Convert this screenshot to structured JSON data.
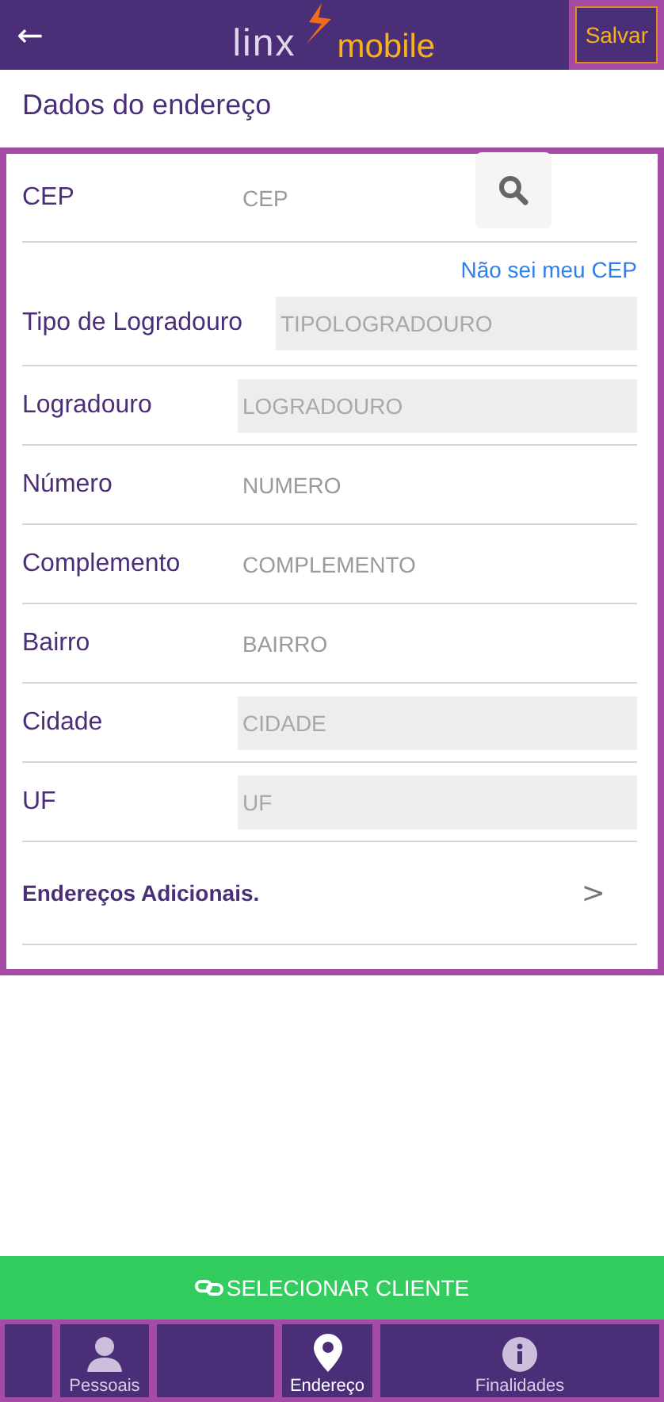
{
  "header": {
    "back": "←",
    "logo_left": "linx",
    "logo_right": "mobile",
    "save": "Salvar"
  },
  "title": "Dados do endereço",
  "cep": {
    "label": "CEP",
    "placeholder": "CEP",
    "link": "Não sei meu CEP"
  },
  "fields": [
    {
      "label": "Tipo de Logradouro",
      "placeholder": "TIPOLOGRADOURO",
      "readonly": true
    },
    {
      "label": "Logradouro",
      "placeholder": "LOGRADOURO",
      "readonly": true
    },
    {
      "label": "Número",
      "placeholder": "NUMERO",
      "readonly": false
    },
    {
      "label": "Complemento",
      "placeholder": "COMPLEMENTO",
      "readonly": false
    },
    {
      "label": "Bairro",
      "placeholder": "BAIRRO",
      "readonly": false
    },
    {
      "label": "Cidade",
      "placeholder": "CIDADE",
      "readonly": true
    },
    {
      "label": "UF",
      "placeholder": "UF",
      "readonly": true
    }
  ],
  "additional": {
    "label": "Endereços Adicionais.",
    "chevron": ">"
  },
  "select_button": "SELECIONAR CLIENTE",
  "tabs": [
    {
      "kind": "blank"
    },
    {
      "kind": "person",
      "label": "Pessoais",
      "selected": false
    },
    {
      "kind": "blank"
    },
    {
      "kind": "pin",
      "label": "Endereço",
      "selected": true
    },
    {
      "kind": "info",
      "label": "Finalidades",
      "selected": false
    }
  ]
}
